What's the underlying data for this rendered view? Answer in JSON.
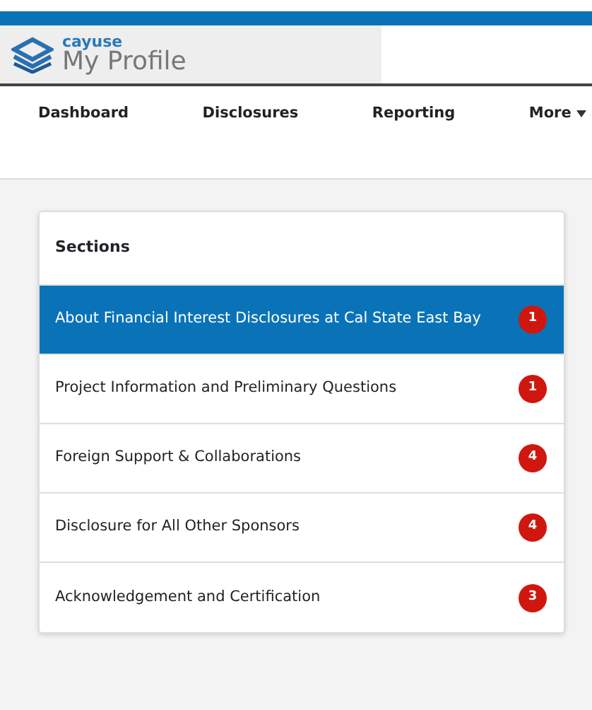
{
  "header": {
    "brand": "cayuse",
    "title": "My Profile"
  },
  "nav": [
    {
      "label": "Dashboard",
      "has_menu": false
    },
    {
      "label": "Disclosures",
      "has_menu": false
    },
    {
      "label": "Reporting",
      "has_menu": false
    },
    {
      "label": "More",
      "has_menu": true
    }
  ],
  "sections": {
    "title": "Sections",
    "items": [
      {
        "label": "About Financial Interest Disclosures at Cal State East Bay",
        "count": "1",
        "selected": true
      },
      {
        "label": "Project Information and Preliminary Questions",
        "count": "1",
        "selected": false
      },
      {
        "label": "Foreign Support & Collaborations",
        "count": "4",
        "selected": false
      },
      {
        "label": "Disclosure for All Other Sponsors",
        "count": "4",
        "selected": false
      },
      {
        "label": "Acknowledgement and Certification",
        "count": "3",
        "selected": false
      }
    ]
  }
}
